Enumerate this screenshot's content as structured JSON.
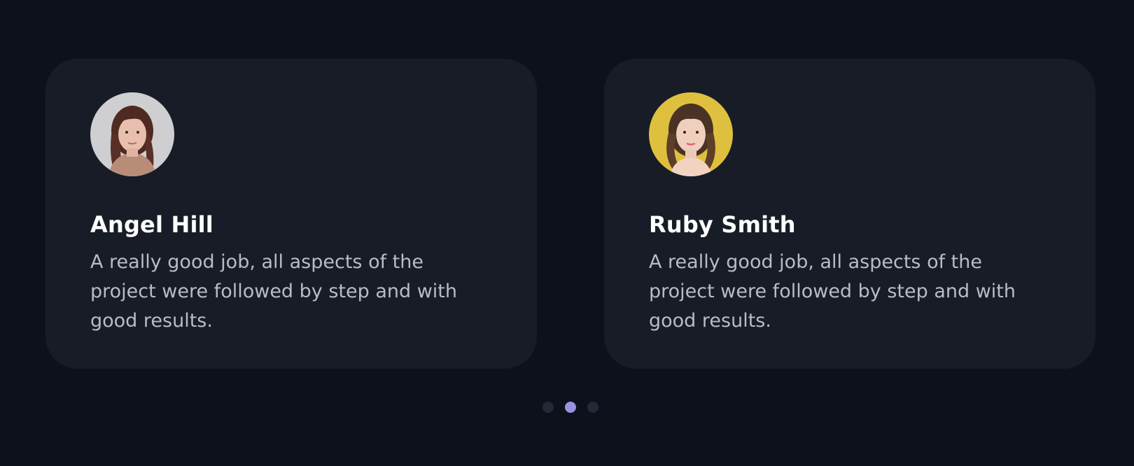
{
  "testimonials": [
    {
      "name": "Angel Hill",
      "quote": "A really good job, all aspects of the project were followed by step and with good results.",
      "avatar_icon": "person-photo-icon"
    },
    {
      "name": "Ruby Smith",
      "quote": "A really good job, all aspects of the project were followed by step and with good results.",
      "avatar_icon": "person-photo-icon"
    }
  ],
  "pagination": {
    "total": 3,
    "active_index": 1
  },
  "colors": {
    "background": "#0c111c",
    "card": "#171c27",
    "name_text": "#ffffff",
    "body_text": "#b9bcc4",
    "dot_active": "#9b8fe2",
    "dot_inactive": "#242a35"
  }
}
